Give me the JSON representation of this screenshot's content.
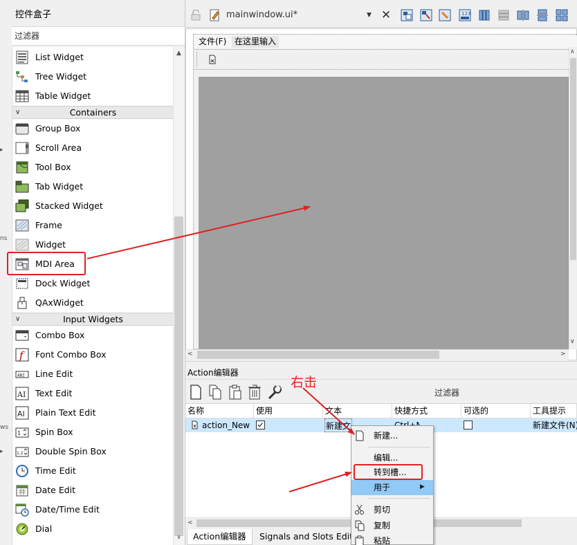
{
  "widgetbox": {
    "title": "控件盒子",
    "filter_placeholder": "过滤器",
    "items_top": [
      {
        "label": "List Widget"
      },
      {
        "label": "Tree Widget"
      },
      {
        "label": "Table Widget"
      }
    ],
    "cat_containers": "Containers",
    "containers": [
      {
        "label": "Group Box"
      },
      {
        "label": "Scroll Area"
      },
      {
        "label": "Tool Box"
      },
      {
        "label": "Tab Widget"
      },
      {
        "label": "Stacked Widget"
      },
      {
        "label": "Frame"
      },
      {
        "label": "Widget"
      },
      {
        "label": "MDI Area"
      },
      {
        "label": "Dock Widget"
      },
      {
        "label": "QAxWidget"
      }
    ],
    "cat_input": "Input Widgets",
    "inputs": [
      {
        "label": "Combo Box"
      },
      {
        "label": "Font Combo Box"
      },
      {
        "label": "Line Edit"
      },
      {
        "label": "Text Edit"
      },
      {
        "label": "Plain Text Edit"
      },
      {
        "label": "Spin Box"
      },
      {
        "label": "Double Spin Box"
      },
      {
        "label": "Time Edit"
      },
      {
        "label": "Date Edit"
      },
      {
        "label": "Date/Time Edit"
      },
      {
        "label": "Dial"
      }
    ],
    "edge_fragments": [
      "ns",
      "ws"
    ]
  },
  "editor": {
    "filename": "mainwindow.ui*",
    "form_menu": {
      "file": "文件(F)",
      "type_here": "在这里输入"
    }
  },
  "action_editor": {
    "title": "Action编辑器",
    "filter_label": "过滤器",
    "columns": [
      "名称",
      "使用",
      "文本",
      "快捷方式",
      "可选的",
      "工具提示"
    ],
    "row": {
      "name": "action_New",
      "used": true,
      "text": "新建文件(&N)",
      "shortcut": "Ctrl+N",
      "checkable": false,
      "tooltip": "新建文件(N)"
    },
    "tabs": [
      "Action编辑器",
      "Signals and Slots Editor"
    ]
  },
  "context_menu": {
    "items": [
      "新建...",
      "编辑...",
      "转到槽...",
      "用于",
      "剪切",
      "复制",
      "粘贴"
    ]
  },
  "annotations": {
    "right_click": "右击"
  }
}
